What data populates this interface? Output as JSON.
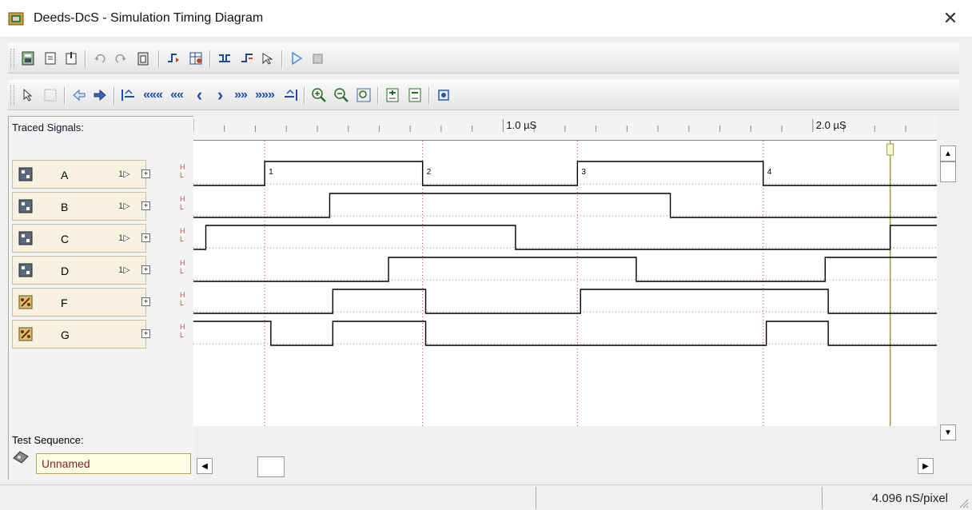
{
  "window": {
    "title": "Deeds-DcS  -  Simulation Timing Diagram",
    "close_glyph": "✕"
  },
  "toolbar1": {
    "icons": [
      "print-icon",
      "new-file-icon",
      "open-file-icon",
      "undo-icon",
      "redo-icon",
      "clipboard-icon",
      "insert-signal-icon",
      "edit-table-icon",
      "split-icon",
      "merge-icon",
      "pointer-signal-icon",
      "play-icon",
      "stop-icon"
    ]
  },
  "toolbar2": {
    "icons": [
      "trace-pointer-icon",
      "trace-grid-icon",
      "arrow-left-icon",
      "arrow-right-icon",
      "go-start-icon",
      "first-icon",
      "fast-back-icon",
      "back-icon",
      "forward-icon",
      "fast-forward-icon",
      "last-icon",
      "go-end-icon",
      "zoom-in-icon",
      "zoom-out-icon",
      "zoom-fit-icon",
      "add-trace-icon",
      "remove-trace-icon",
      "settings-chip-icon"
    ],
    "nav_glyphs": {
      "first": "«««",
      "fast_back": "««",
      "back": "‹",
      "forward": "›",
      "fast_forward": "»»",
      "last": "»»»"
    }
  },
  "panel": {
    "traced_label": "Traced Signals:",
    "test_label": "Test Sequence:",
    "sequence_name": "Unnamed",
    "signals": [
      {
        "name": "A",
        "kind": "input"
      },
      {
        "name": "B",
        "kind": "input"
      },
      {
        "name": "C",
        "kind": "input"
      },
      {
        "name": "D",
        "kind": "input"
      },
      {
        "name": "F",
        "kind": "output"
      },
      {
        "name": "G",
        "kind": "output"
      }
    ],
    "hl": {
      "high": "H",
      "low": "L"
    }
  },
  "ruler": {
    "labels": [
      "1.0 µS",
      "2.0 µS"
    ]
  },
  "markers": [
    "1",
    "2",
    "3",
    "4"
  ],
  "status": {
    "resolution": "4.096 nS/pixel"
  },
  "colors": {
    "cursor_line": "#9c9a4a",
    "marker_dots": "#c04040",
    "wave": "#000000"
  },
  "chart_data": {
    "type": "timing",
    "xlabel": "",
    "x_unit": "µS",
    "xlim": [
      0,
      2.38
    ],
    "ticks_labeled": [
      1.0,
      2.0
    ],
    "marker_times": [
      0.23,
      0.74,
      1.24,
      1.84
    ],
    "cursor_time": 2.25,
    "series": [
      {
        "name": "A",
        "initial": 0,
        "transitions": [
          0.23,
          0.74,
          1.24,
          1.84
        ]
      },
      {
        "name": "B",
        "initial": 0,
        "transitions": [
          0.44,
          1.54
        ]
      },
      {
        "name": "C",
        "initial": 0,
        "transitions": [
          0.04,
          1.04,
          2.25
        ]
      },
      {
        "name": "D",
        "initial": 0,
        "transitions": [
          0.63,
          1.43,
          2.04
        ]
      },
      {
        "name": "F",
        "initial": 0,
        "transitions": [
          0.45,
          0.75,
          1.25,
          2.05
        ]
      },
      {
        "name": "G",
        "initial": 1,
        "transitions": [
          0.25,
          0.45,
          0.75,
          1.85,
          2.05
        ]
      }
    ]
  }
}
